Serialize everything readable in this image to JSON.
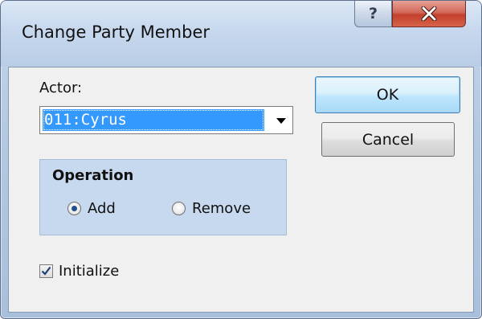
{
  "window": {
    "title": "Change Party Member",
    "help_label": "?",
    "close_label": "close"
  },
  "actor": {
    "label": "Actor:",
    "selected_value": "011:Cyrus"
  },
  "buttons": {
    "ok_label": "OK",
    "cancel_label": "Cancel"
  },
  "operation": {
    "title": "Operation",
    "options": [
      {
        "label": "Add",
        "checked": true
      },
      {
        "label": "Remove",
        "checked": false
      }
    ]
  },
  "initialize": {
    "label": "Initialize",
    "checked": true
  },
  "colors": {
    "selection": "#3399ff",
    "group_background": "#c7d9ee",
    "close_button": "#c3402c"
  }
}
